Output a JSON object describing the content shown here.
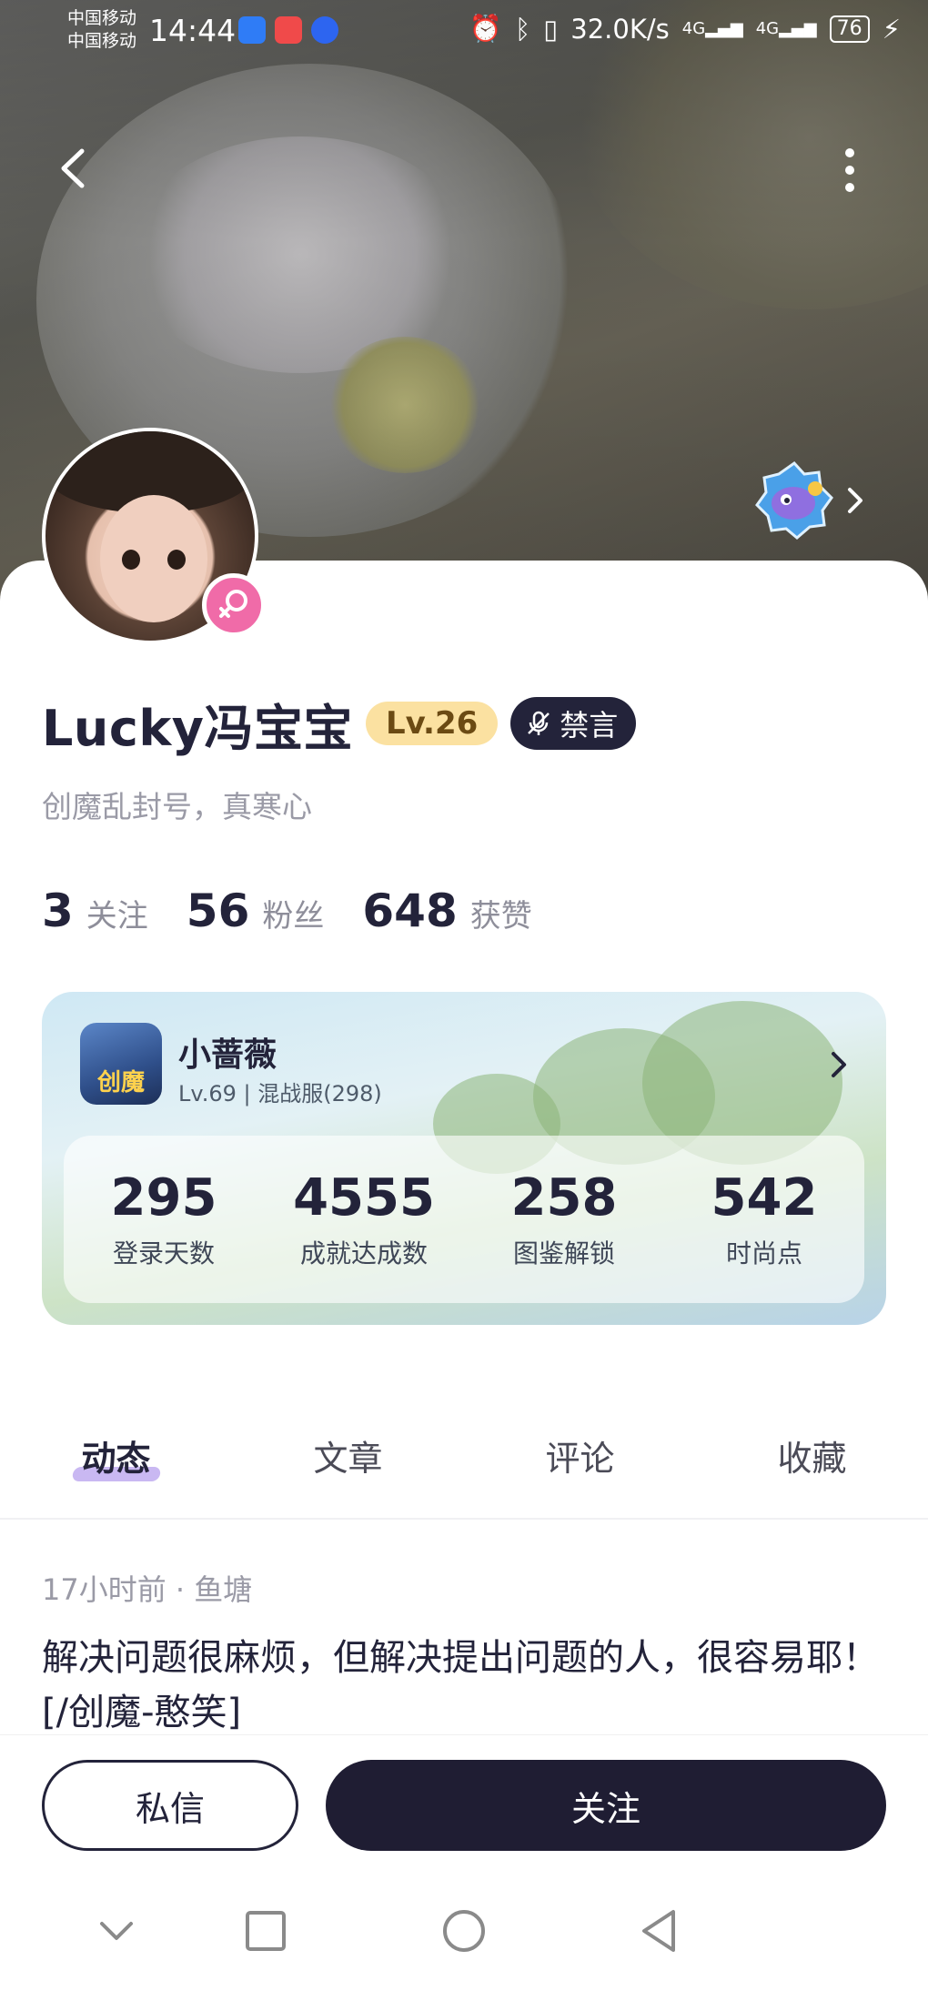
{
  "status_bar": {
    "carrier_1": "中国移动",
    "carrier_2": "中国移动",
    "time": "14:44",
    "net_speed": "32.0K/s",
    "signal_1": "4G",
    "signal_2": "4G",
    "battery": "76"
  },
  "header": {
    "back_icon": "chevron-left-icon",
    "more_icon": "more-vertical-icon",
    "badge_icon": "fish-emblem-icon"
  },
  "profile": {
    "username": "Lucky冯宝宝",
    "level": "Lv.26",
    "muted_label": "禁言",
    "signature": "创魔乱封号，真寒心",
    "gender": "female",
    "stats": [
      {
        "value": "3",
        "label": "关注"
      },
      {
        "value": "56",
        "label": "粉丝"
      },
      {
        "value": "648",
        "label": "获赞"
      }
    ]
  },
  "game_card": {
    "game_icon_text": "创魔",
    "character_name": "小蔷薇",
    "character_sub": "Lv.69 | 混战服(298)",
    "stats": [
      {
        "value": "295",
        "label": "登录天数"
      },
      {
        "value": "4555",
        "label": "成就达成数"
      },
      {
        "value": "258",
        "label": "图鉴解锁"
      },
      {
        "value": "542",
        "label": "时尚点"
      }
    ]
  },
  "tabs": [
    {
      "label": "动态",
      "active": true
    },
    {
      "label": "文章",
      "active": false
    },
    {
      "label": "评论",
      "active": false
    },
    {
      "label": "收藏",
      "active": false
    }
  ],
  "post": {
    "meta": "17小时前 · 鱼塘",
    "body": "解决问题很麻烦，但解决提出问题的人，很容易耶！ [/创魔-憨笑]"
  },
  "actions": {
    "dm_label": "私信",
    "follow_label": "关注"
  },
  "colors": {
    "primary_dark": "#1f1d33",
    "level_bg": "#fbe1a1",
    "gender_pink": "#f06ba8",
    "tab_underline": "#c9b8f2"
  }
}
